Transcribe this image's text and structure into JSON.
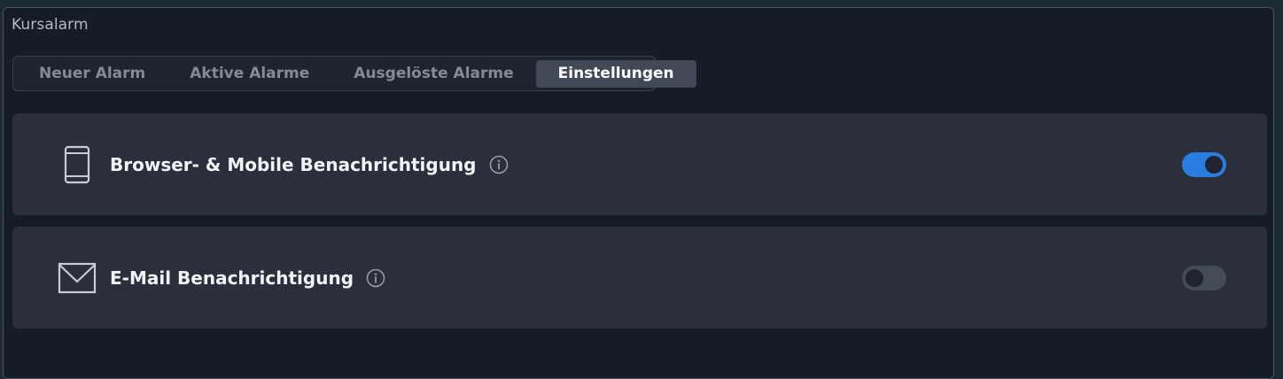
{
  "window": {
    "title": "Kursalarm"
  },
  "tabs": [
    {
      "label": "Neuer Alarm",
      "active": false
    },
    {
      "label": "Aktive Alarme",
      "active": false
    },
    {
      "label": "Ausgelöste Alarme",
      "active": false
    },
    {
      "label": "Einstellungen",
      "active": true
    }
  ],
  "settings": [
    {
      "label": "Browser- & Mobile Benachrichtigung",
      "icon": "mobile-phone-icon",
      "enabled": true
    },
    {
      "label": "E-Mail Benachrichtigung",
      "icon": "envelope-icon",
      "enabled": false
    }
  ],
  "colors": {
    "accent": "#2a7de1",
    "background": "#161c25",
    "panel": "#2a2f3b",
    "active_tab": "#414856"
  }
}
